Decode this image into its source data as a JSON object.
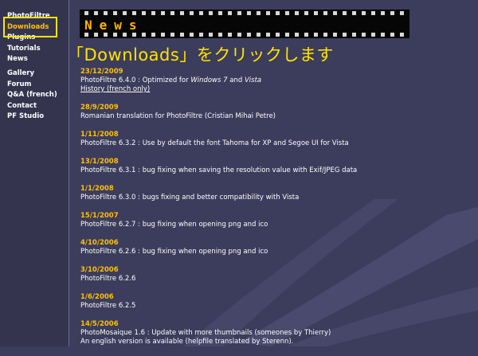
{
  "nav": {
    "group1": [
      {
        "label": "PhotoFiltre",
        "active": false
      },
      {
        "label": "Downloads",
        "active": true
      },
      {
        "label": "Plugins",
        "active": false
      },
      {
        "label": "Tutorials",
        "active": false
      },
      {
        "label": "News",
        "active": false
      }
    ],
    "group2": [
      {
        "label": "Gallery"
      },
      {
        "label": "Forum"
      },
      {
        "label": "Q&A (french)"
      },
      {
        "label": "Contact"
      },
      {
        "label": "PF Studio"
      }
    ]
  },
  "header": {
    "title": "News"
  },
  "instruction": "「Downloads」をクリックします",
  "news": [
    {
      "date": "23/12/2009",
      "text_pre": "PhotoFiltre 6.4.0 : Optimized for ",
      "text_em1": "Windows 7",
      "text_mid": " and ",
      "text_em2": "Vista",
      "link": "History (french only)"
    },
    {
      "date": "28/9/2009",
      "text": "Romanian translation for PhotoFiltre (Cristian Mihai Petre)"
    },
    {
      "date": "1/11/2008",
      "text": "PhotoFiltre 6.3.2 : Use by default the font Tahoma for XP and Segoe UI for Vista"
    },
    {
      "date": "13/1/2008",
      "text": "PhotoFiltre 6.3.1 : bug fixing when saving the resolution value with Exif/JPEG data"
    },
    {
      "date": "1/1/2008",
      "text": "PhotoFiltre 6.3.0 : bugs fixing and better compatibility with Vista"
    },
    {
      "date": "15/1/2007",
      "text": "PhotoFiltre 6.2.7 : bug fixing when opening png and ico"
    },
    {
      "date": "4/10/2006",
      "text": "PhotoFiltre 6.2.6 : bug fixing when opening png and ico"
    },
    {
      "date": "3/10/2006",
      "text": "PhotoFiltre 6.2.6"
    },
    {
      "date": "1/6/2006",
      "text": "PhotoFiltre 6.2.5"
    },
    {
      "date": "14/5/2006",
      "text": "PhotoMosaique 1.6 : Update with more thumbnails (someones by Thierry)",
      "text2": "An english version is available (helpfile translated by Sterenn)."
    }
  ]
}
